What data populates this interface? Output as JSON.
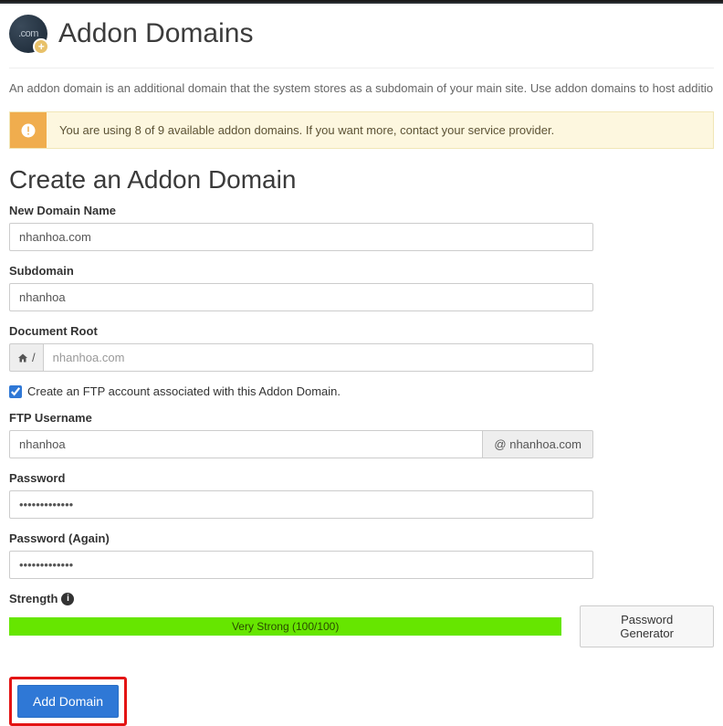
{
  "header": {
    "icon_label": ".com",
    "title": "Addon Domains"
  },
  "description": "An addon domain is an additional domain that the system stores as a subdomain of your main site. Use addon domains to host addition",
  "alert": {
    "text": "You are using 8 of 9 available addon domains. If you want more, contact your service provider."
  },
  "section_title": "Create an Addon Domain",
  "form": {
    "new_domain": {
      "label": "New Domain Name",
      "value": "nhanhoa.com"
    },
    "subdomain": {
      "label": "Subdomain",
      "value": "nhanhoa"
    },
    "document_root": {
      "label": "Document Root",
      "prefix": "/",
      "placeholder": "nhanhoa.com"
    },
    "ftp_checkbox": {
      "label": "Create an FTP account associated with this Addon Domain.",
      "checked": true
    },
    "ftp_user": {
      "label": "FTP Username",
      "value": "nhanhoa",
      "suffix": "@ nhanhoa.com"
    },
    "password": {
      "label": "Password",
      "value": "•••••••••••••"
    },
    "password_again": {
      "label": "Password (Again)",
      "value": "•••••••••••••"
    },
    "strength": {
      "label": "Strength",
      "text": "Very Strong (100/100)"
    },
    "password_generator": "Password Generator",
    "submit": "Add Domain"
  }
}
